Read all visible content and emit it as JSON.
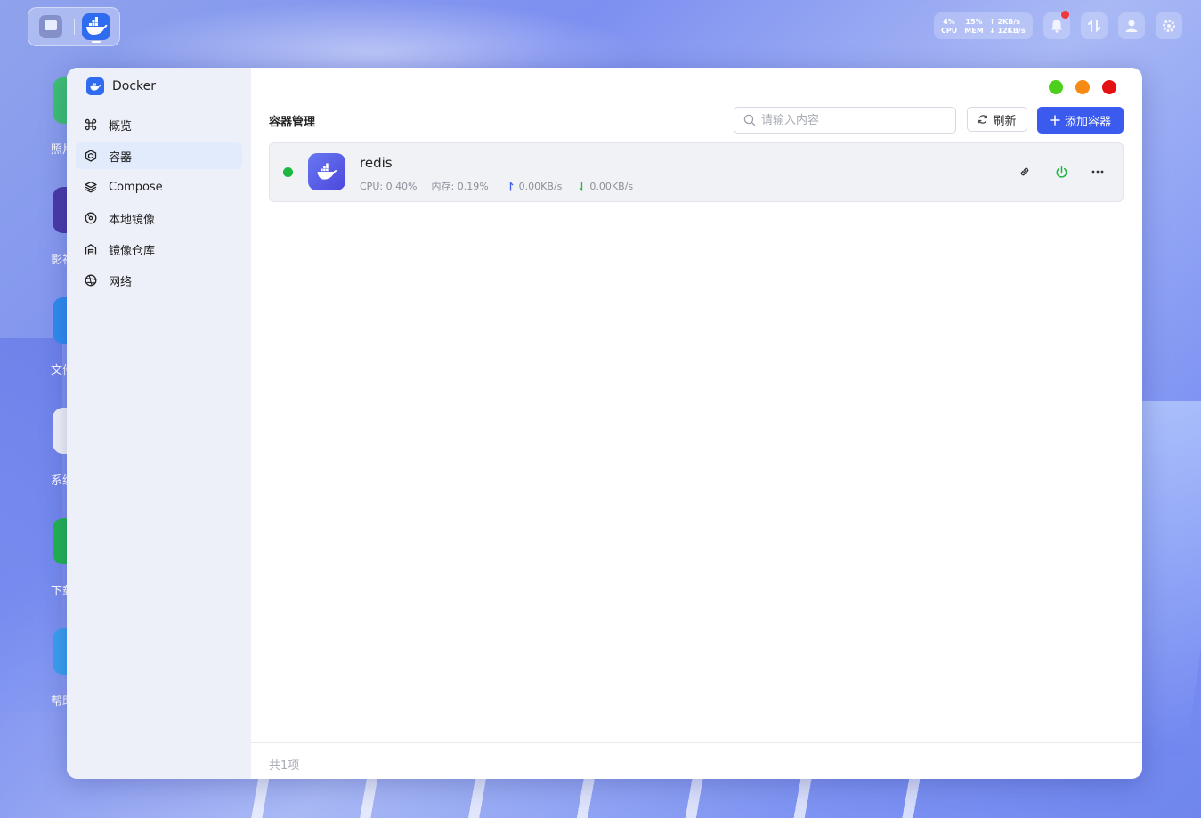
{
  "taskbar": {
    "stats": {
      "cpu_value": "4%",
      "cpu_label": "CPU",
      "mem_value": "15%",
      "mem_label": "MEM",
      "net_up": "↑ 2KB/s",
      "net_down": "↓ 12KB/s"
    }
  },
  "desktop_icons": [
    {
      "label": "照片",
      "color": "#3ec173"
    },
    {
      "label": "影视",
      "color": "#4a3aa8"
    },
    {
      "label": "文件",
      "color": "#2f8cf0"
    },
    {
      "label": "系统",
      "color": "#f2f4fa"
    },
    {
      "label": "下载",
      "color": "#22b451"
    },
    {
      "label": "帮助",
      "color": "#3aa0f0"
    }
  ],
  "app": {
    "name": "Docker"
  },
  "sidebar": {
    "items": [
      {
        "label": "概览",
        "icon": "command-icon"
      },
      {
        "label": "容器",
        "icon": "hexagon-box-icon",
        "active": true
      },
      {
        "label": "Compose",
        "icon": "layers-icon"
      },
      {
        "label": "本地镜像",
        "icon": "disc-icon"
      },
      {
        "label": "镜像仓库",
        "icon": "warehouse-icon"
      },
      {
        "label": "网络",
        "icon": "network-globe-icon"
      }
    ]
  },
  "window_controls": {
    "colors": [
      "#4cd01c",
      "#f78a13",
      "#e51013"
    ]
  },
  "main": {
    "title": "容器管理",
    "search": {
      "placeholder": "请输入内容",
      "value": ""
    },
    "refresh_label": "刷新",
    "add_label": "添加容器",
    "accent": "#3b5bef"
  },
  "containers": [
    {
      "name": "redis",
      "status": "running",
      "status_color": "#1bb73f",
      "cpu": "CPU: 0.40%",
      "mem": "内存: 0.19%",
      "up": "0.00KB/s",
      "down": "0.00KB/s"
    }
  ],
  "footer": {
    "total": "共1项"
  }
}
